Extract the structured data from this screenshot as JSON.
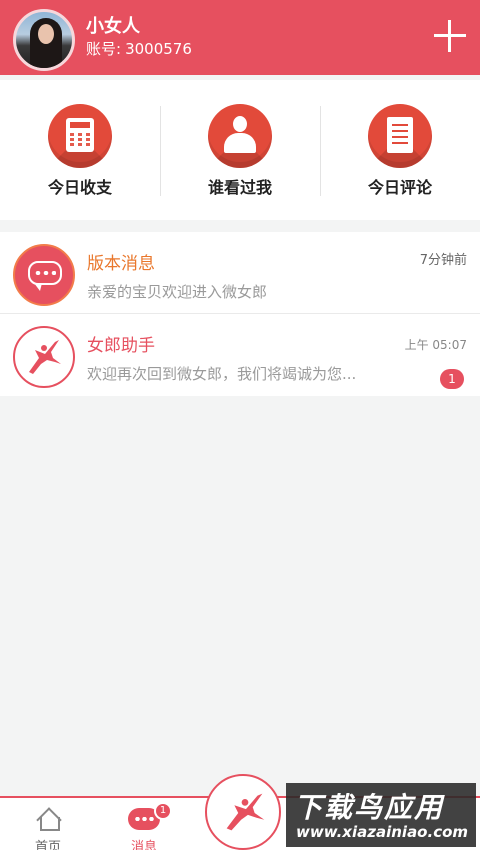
{
  "header": {
    "username": "小女人",
    "account_label": "账号:",
    "account_number": "3000576",
    "accent_color": "#e6505f"
  },
  "quick_actions": [
    {
      "label": "今日收支",
      "icon": "calculator-icon"
    },
    {
      "label": "谁看过我",
      "icon": "person-icon"
    },
    {
      "label": "今日评论",
      "icon": "document-icon"
    }
  ],
  "messages": [
    {
      "title": "版本消息",
      "title_color": "#e9772c",
      "preview": "亲爱的宝贝欢迎进入微女郎",
      "time": "7分钟前",
      "icon": "chat-bubble-icon"
    },
    {
      "title": "女郎助手",
      "title_color": "#e6505f",
      "preview": "欢迎再次回到微女郎，我们将竭诚为您...",
      "time": "上午 05:07",
      "badge": "1",
      "icon": "dancer-logo-icon"
    }
  ],
  "tabbar": {
    "tabs": [
      {
        "label": "首页",
        "icon": "home-icon"
      },
      {
        "label": "消息",
        "icon": "message-icon",
        "badge": "1",
        "color": "#e6505f"
      }
    ],
    "center_icon": "dancer-logo-icon"
  },
  "watermark": {
    "title": "下载鸟应用",
    "url": "www.xiazainiao.com"
  }
}
